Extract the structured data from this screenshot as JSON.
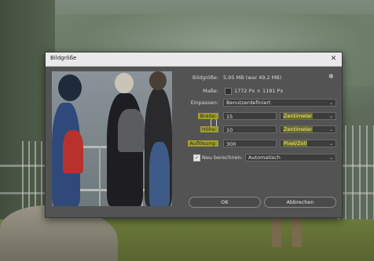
{
  "dialog": {
    "title": "Bildgröße",
    "close_icon": "close-icon",
    "image_size_label": "Bildgröße:",
    "image_size_value": "5,95 MB (war 49,2 MB)",
    "dimensions_label": "Maße:",
    "dimensions_value": "1772 Px  ×  1181 Px",
    "fit_label": "Einpassen:",
    "fit_value": "Benutzerdefiniert",
    "width_label": "Breite:",
    "width_value": "15",
    "width_unit": "Zentimeter",
    "height_label": "Höhe:",
    "height_value": "10",
    "height_unit": "Zentimeter",
    "resolution_label": "Auflösung:",
    "resolution_value": "300",
    "resolution_unit": "Pixel/Zoll",
    "resample_label": "Neu berechnen:",
    "resample_checked": true,
    "resample_value": "Automatisch",
    "ok_label": "OK",
    "cancel_label": "Abbrechen"
  }
}
